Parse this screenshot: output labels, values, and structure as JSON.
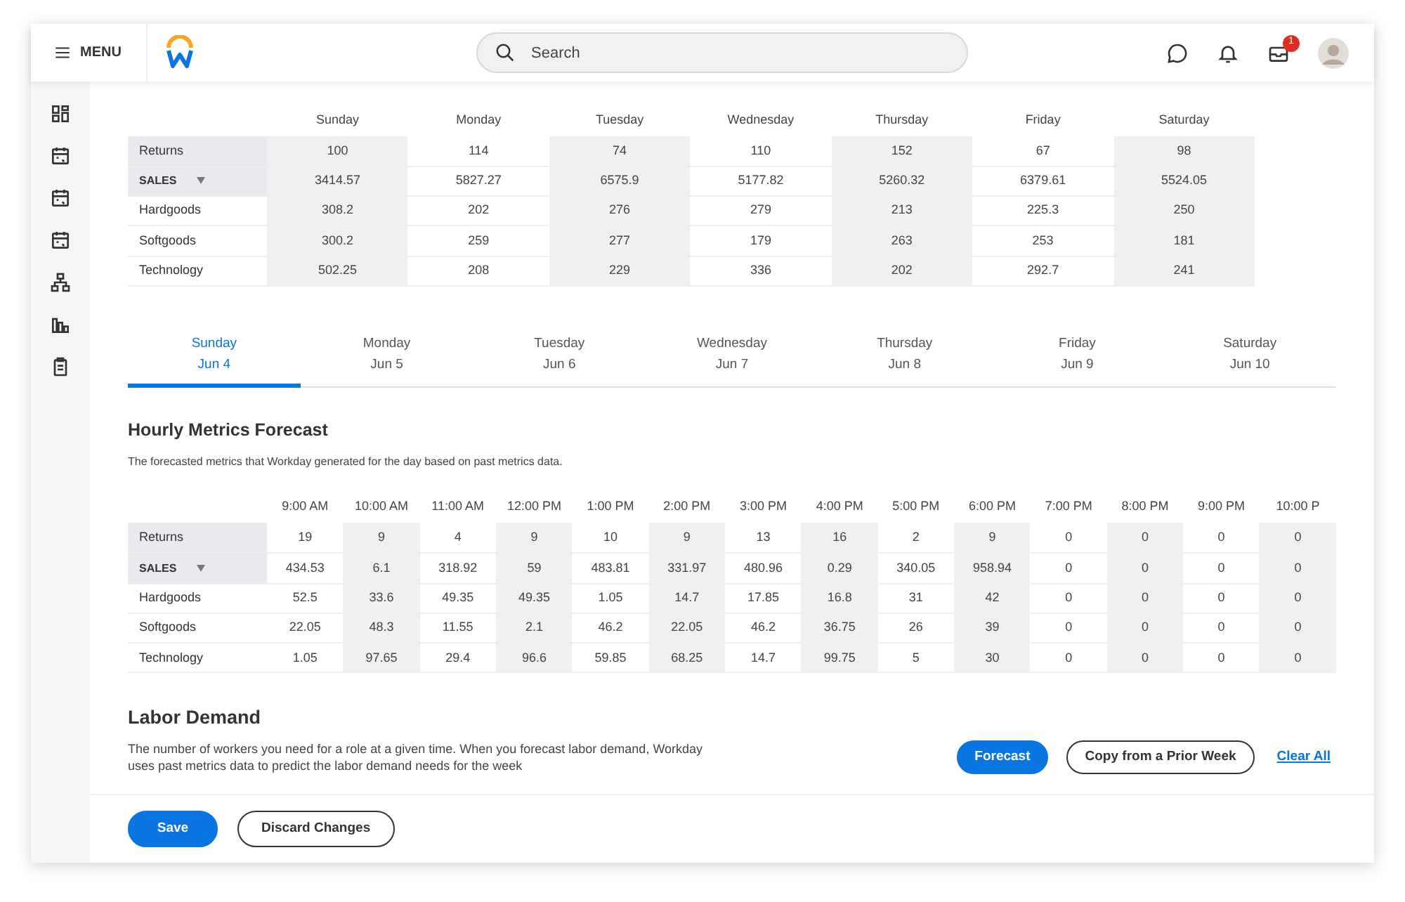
{
  "header": {
    "menu_label": "MENU",
    "search": {
      "placeholder": "Search"
    },
    "inbox_badge": "1"
  },
  "weekly_table": {
    "columns": [
      {
        "label": "Sunday",
        "shaded": true
      },
      {
        "label": "Monday",
        "shaded": false
      },
      {
        "label": "Tuesday",
        "shaded": true
      },
      {
        "label": "Wednesday",
        "shaded": false
      },
      {
        "label": "Thursday",
        "shaded": true
      },
      {
        "label": "Friday",
        "shaded": false
      },
      {
        "label": "Saturday",
        "shaded": true
      }
    ],
    "rows": [
      {
        "kind": "metric",
        "label": "Returns",
        "values": [
          "100",
          "114",
          "74",
          "110",
          "152",
          "67",
          "98"
        ]
      },
      {
        "kind": "total",
        "label": "SALES",
        "dropdown": true,
        "values": [
          "3414.57",
          "5827.27",
          "6575.9",
          "5177.82",
          "5260.32",
          "6379.61",
          "5524.05"
        ]
      },
      {
        "kind": "category",
        "label": "Hardgoods",
        "values": [
          "308.2",
          "202",
          "276",
          "279",
          "213",
          "225.3",
          "250"
        ]
      },
      {
        "kind": "category",
        "label": "Softgoods",
        "values": [
          "300.2",
          "259",
          "277",
          "179",
          "263",
          "253",
          "181"
        ]
      },
      {
        "kind": "category",
        "label": "Technology",
        "values": [
          "502.25",
          "208",
          "229",
          "336",
          "202",
          "292.7",
          "241"
        ]
      }
    ]
  },
  "day_tabs": [
    {
      "day": "Sunday",
      "date": "Jun 4",
      "selected": true
    },
    {
      "day": "Monday",
      "date": "Jun 5",
      "selected": false
    },
    {
      "day": "Tuesday",
      "date": "Jun 6",
      "selected": false
    },
    {
      "day": "Wednesday",
      "date": "Jun 7",
      "selected": false
    },
    {
      "day": "Thursday",
      "date": "Jun 8",
      "selected": false
    },
    {
      "day": "Friday",
      "date": "Jun 9",
      "selected": false
    },
    {
      "day": "Saturday",
      "date": "Jun 10",
      "selected": false
    }
  ],
  "hourly": {
    "title": "Hourly Metrics Forecast",
    "description": "The forecasted metrics that Workday generated for the day based on past metrics data.",
    "table": {
      "columns": [
        {
          "label": "9:00 AM",
          "shaded": false
        },
        {
          "label": "10:00 AM",
          "shaded": true
        },
        {
          "label": "11:00 AM",
          "shaded": false
        },
        {
          "label": "12:00 PM",
          "shaded": true
        },
        {
          "label": "1:00 PM",
          "shaded": false
        },
        {
          "label": "2:00 PM",
          "shaded": true
        },
        {
          "label": "3:00 PM",
          "shaded": false
        },
        {
          "label": "4:00 PM",
          "shaded": true
        },
        {
          "label": "5:00 PM",
          "shaded": false
        },
        {
          "label": "6:00 PM",
          "shaded": true
        },
        {
          "label": "7:00 PM",
          "shaded": false
        },
        {
          "label": "8:00 PM",
          "shaded": true
        },
        {
          "label": "9:00 PM",
          "shaded": false
        },
        {
          "label": "10:00 P",
          "shaded": true
        }
      ],
      "rows": [
        {
          "kind": "metric",
          "label": "Returns",
          "values": [
            "19",
            "9",
            "4",
            "9",
            "10",
            "9",
            "13",
            "16",
            "2",
            "9",
            "0",
            "0",
            "0",
            "0"
          ]
        },
        {
          "kind": "total",
          "label": "SALES",
          "dropdown": true,
          "values": [
            "434.53",
            "6.1",
            "318.92",
            "59",
            "483.81",
            "331.97",
            "480.96",
            "0.29",
            "340.05",
            "958.94",
            "0",
            "0",
            "0",
            "0"
          ]
        },
        {
          "kind": "category",
          "label": "Hardgoods",
          "values": [
            "52.5",
            "33.6",
            "49.35",
            "49.35",
            "1.05",
            "14.7",
            "17.85",
            "16.8",
            "31",
            "42",
            "0",
            "0",
            "0",
            "0"
          ]
        },
        {
          "kind": "category",
          "label": "Softgoods",
          "values": [
            "22.05",
            "48.3",
            "11.55",
            "2.1",
            "46.2",
            "22.05",
            "46.2",
            "36.75",
            "26",
            "39",
            "0",
            "0",
            "0",
            "0"
          ]
        },
        {
          "kind": "category",
          "label": "Technology",
          "values": [
            "1.05",
            "97.65",
            "29.4",
            "96.6",
            "59.85",
            "68.25",
            "14.7",
            "99.75",
            "5",
            "30",
            "0",
            "0",
            "0",
            "0"
          ]
        }
      ]
    }
  },
  "labor_demand": {
    "title": "Labor Demand",
    "description": "The number of workers you need for a role at a given time. When you forecast labor demand, Workday uses past metrics data to predict the labor demand needs for the week",
    "actions": [
      {
        "kind": "primary",
        "label": "Forecast"
      },
      {
        "kind": "outline",
        "label": "Copy from a Prior Week"
      },
      {
        "kind": "link",
        "label": "Clear All"
      }
    ]
  },
  "footer": {
    "actions": [
      {
        "kind": "primary",
        "label": "Save"
      },
      {
        "kind": "outline",
        "label": "Discard Changes"
      }
    ]
  }
}
